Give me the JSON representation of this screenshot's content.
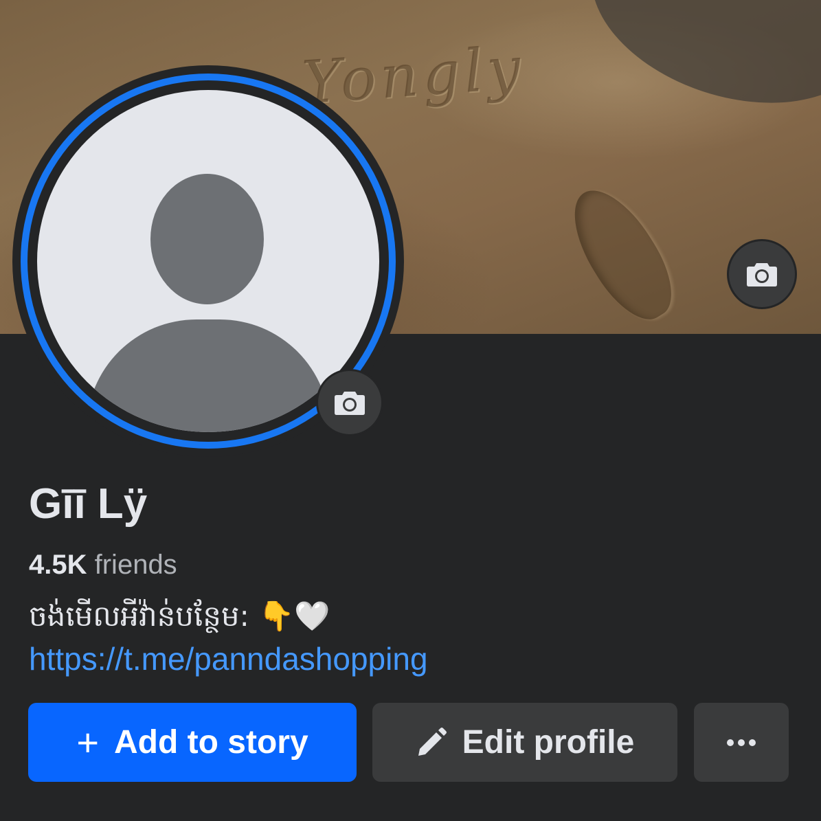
{
  "cover": {
    "sand_text": "Yongly"
  },
  "profile": {
    "name": "Gīī Lÿ",
    "friends_count": "4.5K",
    "friends_label": "friends",
    "bio": "ចង់មើលអីវ៉ាន់បន្ថែម: 👇🤍",
    "link": "https://t.me/panndashopping"
  },
  "actions": {
    "add_story_label": "Add to story",
    "edit_profile_label": "Edit profile"
  },
  "icons": {
    "cover_camera": "camera-icon",
    "avatar_camera": "camera-icon",
    "add": "plus-icon",
    "edit": "pencil-icon",
    "more": "ellipsis-icon"
  },
  "colors": {
    "accent": "#0866ff",
    "link": "#4599ff",
    "ring": "#1877f2",
    "background": "#242526"
  }
}
